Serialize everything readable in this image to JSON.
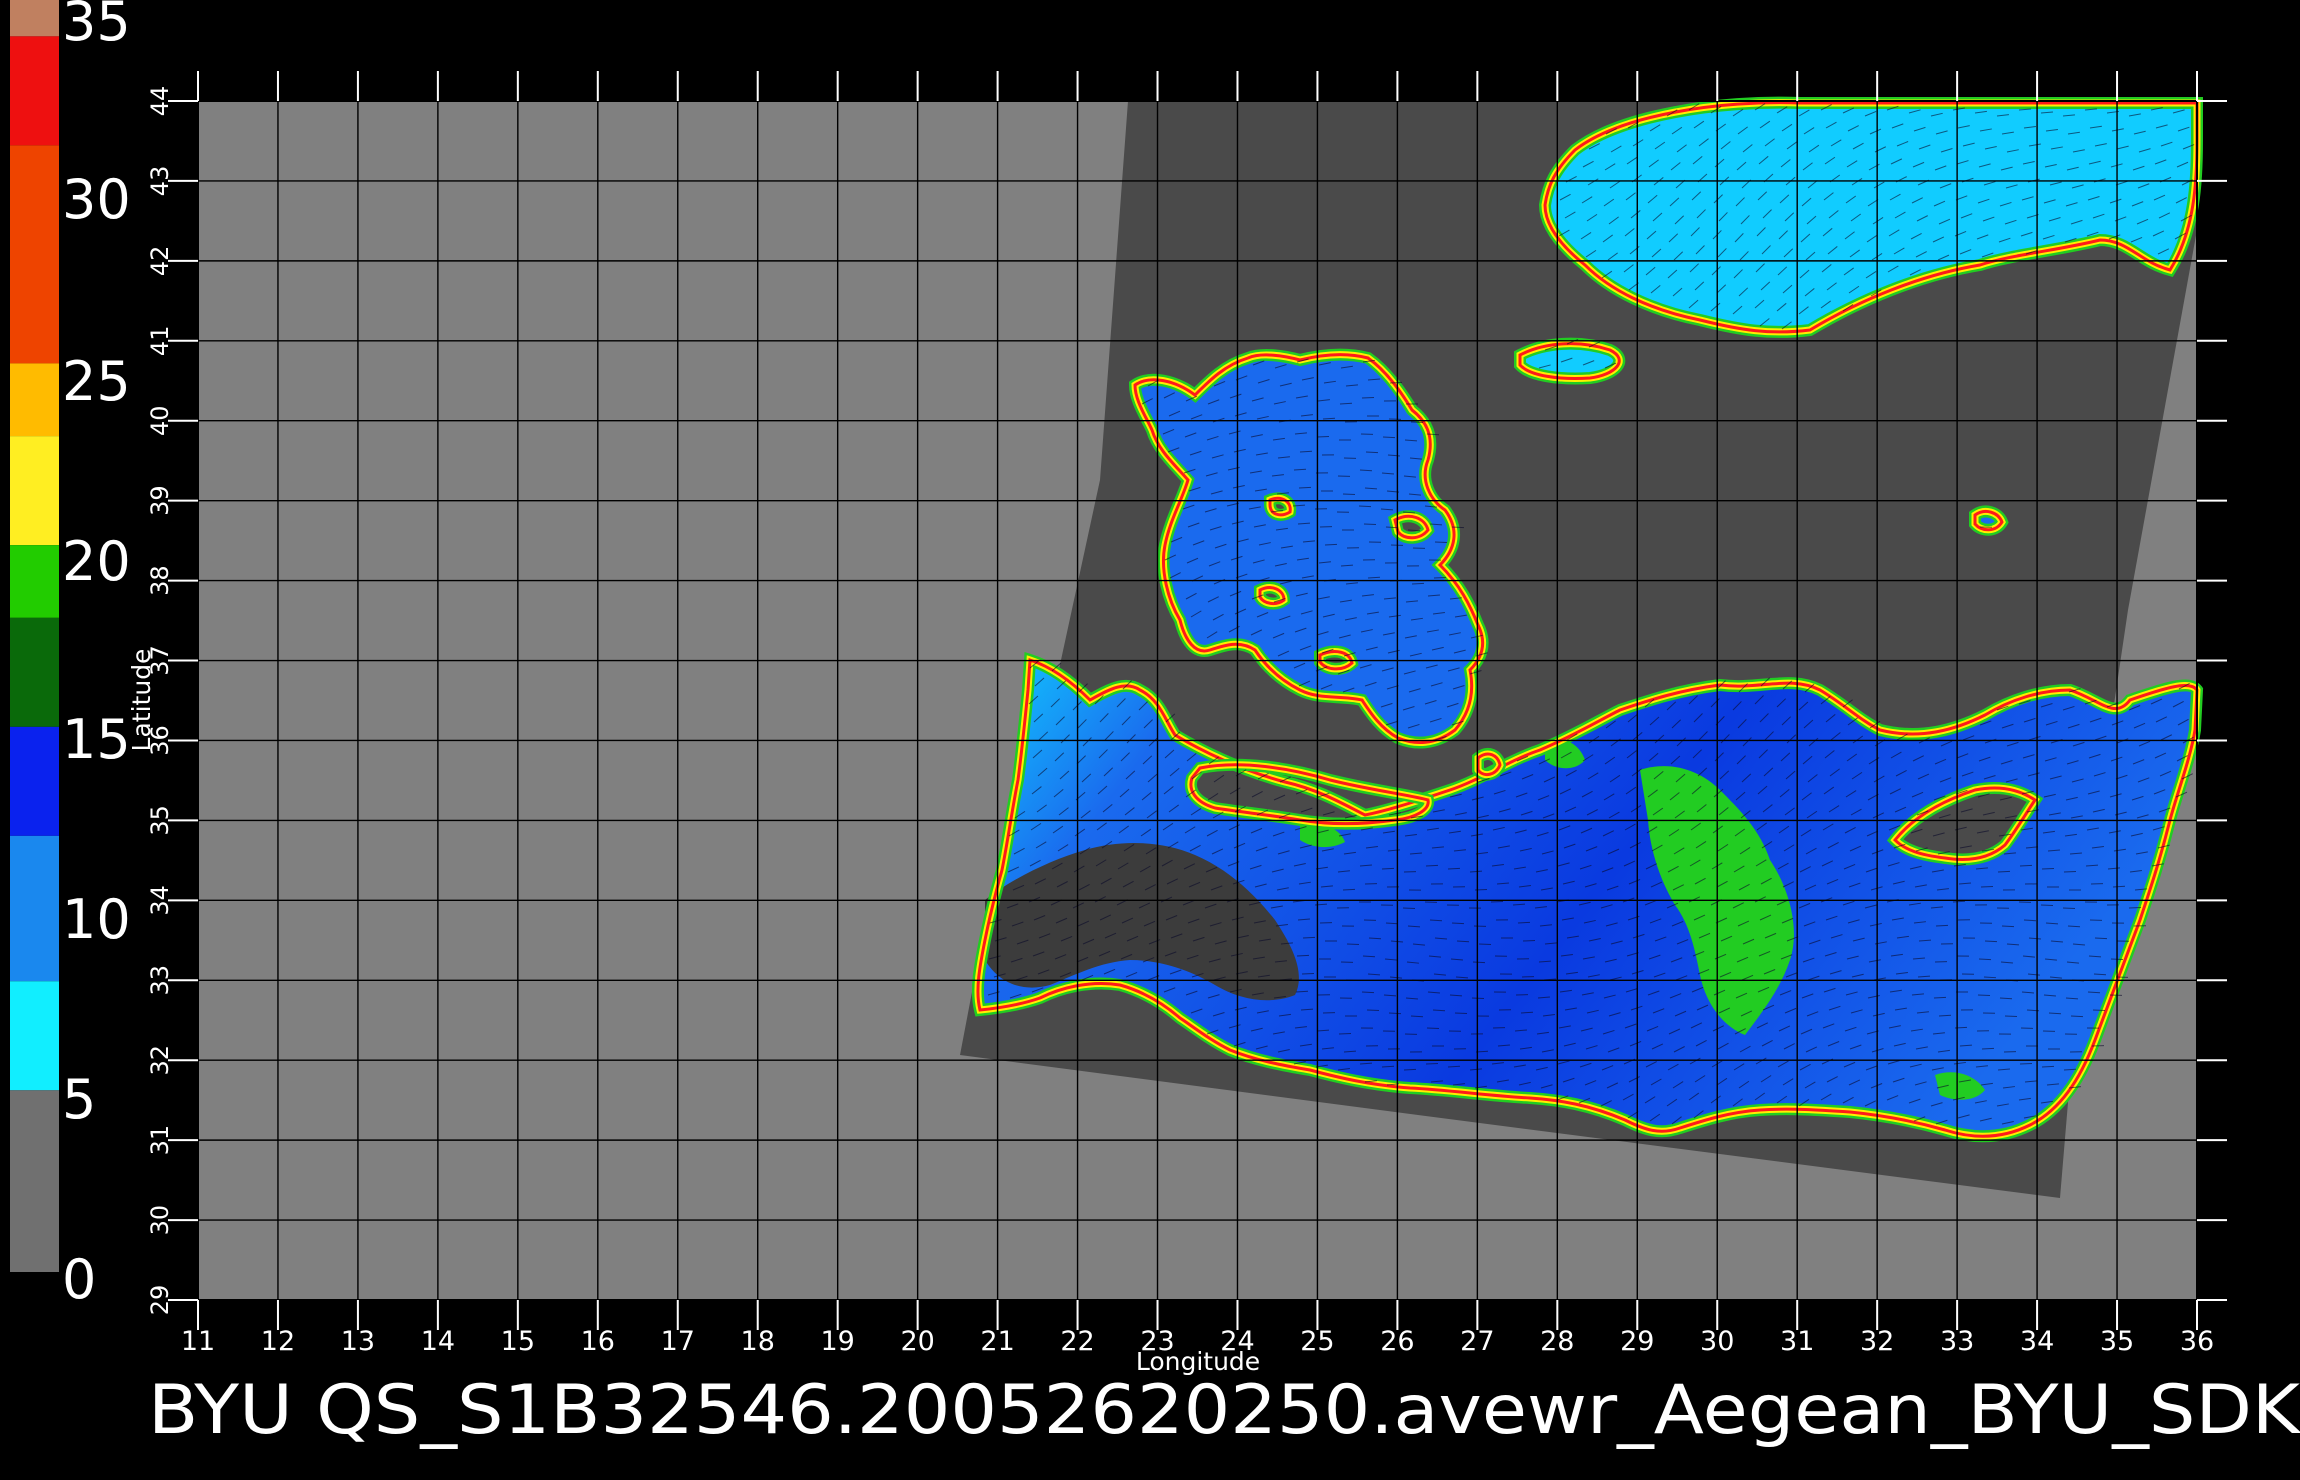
{
  "colorbar": {
    "ticks": [
      "35",
      "30",
      "25",
      "20",
      "15",
      "10",
      "5",
      "0"
    ],
    "stops": [
      {
        "from": 35,
        "to": 34,
        "color": "#c08060"
      },
      {
        "from": 34,
        "to": 31,
        "color": "#ee1010"
      },
      {
        "from": 31,
        "to": 25,
        "color": "#ee4400"
      },
      {
        "from": 25,
        "to": 23,
        "color": "#ffbb00"
      },
      {
        "from": 23,
        "to": 20,
        "color": "#ffee22"
      },
      {
        "from": 20,
        "to": 18,
        "color": "#22cc00"
      },
      {
        "from": 18,
        "to": 15,
        "color": "#0a6a0a"
      },
      {
        "from": 15,
        "to": 12,
        "color": "#0a22ee"
      },
      {
        "from": 12,
        "to": 8,
        "color": "#1a88ee"
      },
      {
        "from": 8,
        "to": 5,
        "color": "#11eeff"
      },
      {
        "from": 5,
        "to": 0,
        "color": "#707070"
      }
    ]
  },
  "map": {
    "x_label": "Longitude",
    "y_label": "Latitude",
    "lon_range": [
      11,
      36
    ],
    "lat_range": [
      29,
      44
    ],
    "lon_ticks": [
      "11",
      "12",
      "13",
      "14",
      "15",
      "16",
      "17",
      "18",
      "19",
      "20",
      "21",
      "22",
      "23",
      "24",
      "25",
      "26",
      "27",
      "28",
      "29",
      "30",
      "31",
      "32",
      "33",
      "34",
      "35",
      "36"
    ],
    "lat_ticks": [
      "29",
      "30",
      "31",
      "32",
      "33",
      "34",
      "35",
      "36",
      "37",
      "38",
      "39",
      "40",
      "41",
      "42",
      "43",
      "44"
    ],
    "colors": {
      "background": "#808080",
      "swath": "#4a4a4a",
      "grid": "#000000",
      "sea_low": "#11ccff",
      "sea_mid": "#1a6aee",
      "sea_high": "#0a3ae0",
      "coast_red": "#ff1a1a",
      "coast_yellow": "#ffee00",
      "coast_green": "#22cc22",
      "dark_patch": "#3c3c3c"
    }
  },
  "footer": {
    "title": "BYU  QS_S1B32546.20052620250.avewr_Aegean_BYU_SDK"
  }
}
